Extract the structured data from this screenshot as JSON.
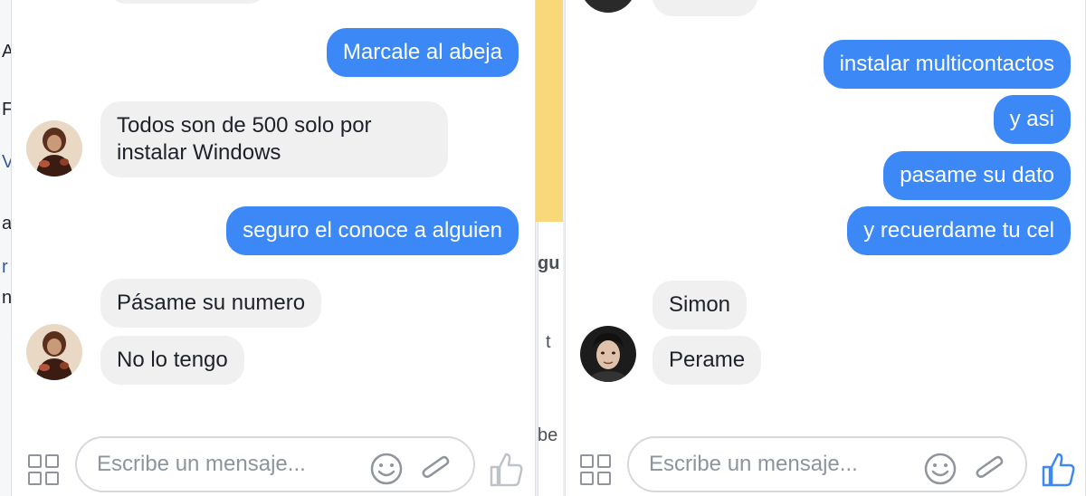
{
  "left_chat": {
    "messages": [
      {
        "text": "Marcale al abeja"
      },
      {
        "text": "Todos son de 500 solo por instalar Windows"
      },
      {
        "text": "seguro el conoce a alguien"
      },
      {
        "text": "Pásame su numero"
      },
      {
        "text": "No lo tengo"
      }
    ],
    "composer": {
      "placeholder": "Escribe un mensaje..."
    }
  },
  "right_chat": {
    "messages": [
      {
        "text": "instalar multicontactos"
      },
      {
        "text": "y asi"
      },
      {
        "text": "pasame su dato"
      },
      {
        "text": "y recuerdame tu cel"
      },
      {
        "text": "Simon"
      },
      {
        "text": "Perame"
      }
    ],
    "composer": {
      "placeholder": "Escribe un mensaje..."
    }
  },
  "background": {
    "left_letters": [
      "A",
      "F",
      "V",
      "a",
      "r",
      "n"
    ],
    "mid_text": [
      "gu",
      "t",
      "be"
    ]
  },
  "colors": {
    "outgoing_bubble": "#3c88f7",
    "incoming_bubble": "#f1f0f0",
    "like_active": "#3c88f7",
    "like_inactive": "#bec3c9"
  },
  "icons": [
    "apps-grid-icon",
    "emoji-icon",
    "paperclip-icon",
    "thumbs-up-icon"
  ]
}
